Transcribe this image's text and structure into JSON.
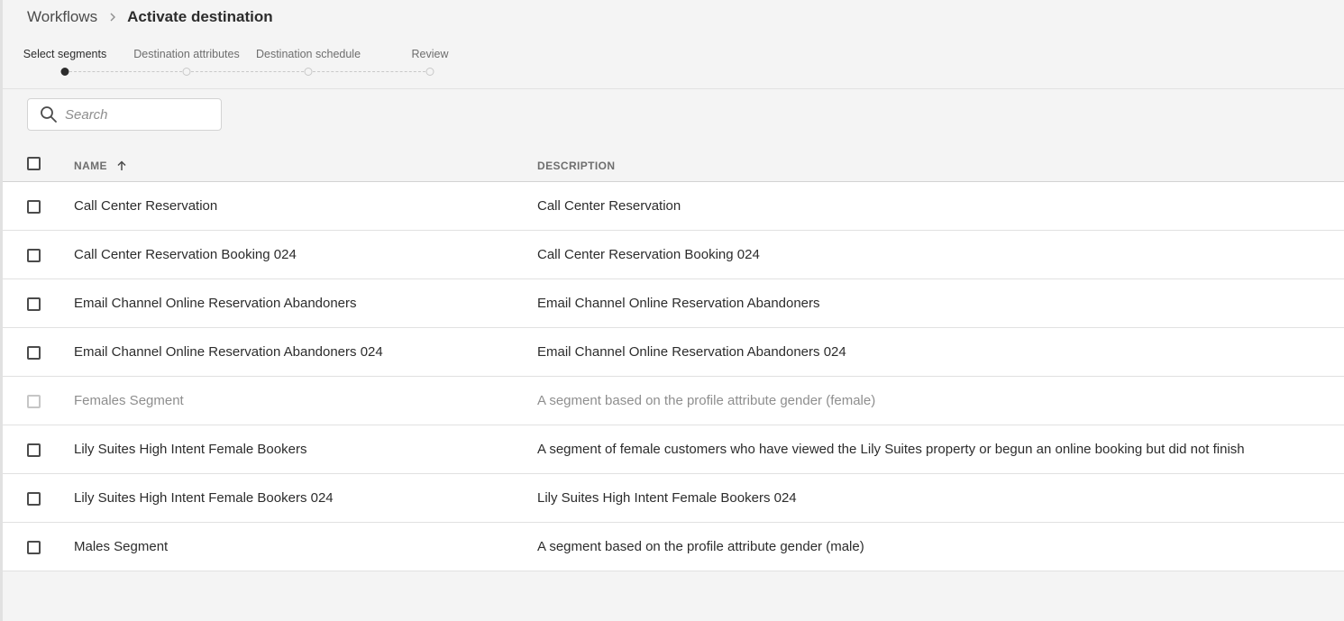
{
  "breadcrumb": {
    "parent": "Workflows",
    "current": "Activate destination"
  },
  "steps": [
    {
      "label": "Select segments",
      "active": true
    },
    {
      "label": "Destination attributes",
      "active": false
    },
    {
      "label": "Destination schedule",
      "active": false
    },
    {
      "label": "Review",
      "active": false
    }
  ],
  "search": {
    "placeholder": "Search",
    "value": ""
  },
  "table": {
    "columns": {
      "name": "NAME",
      "description": "DESCRIPTION"
    },
    "sort": {
      "column": "name",
      "direction": "ascending"
    },
    "rows": [
      {
        "name": "Call Center Reservation",
        "description": "Call Center Reservation",
        "disabled": false
      },
      {
        "name": "Call Center Reservation Booking 024",
        "description": "Call Center Reservation Booking 024",
        "disabled": false
      },
      {
        "name": "Email Channel Online Reservation Abandoners",
        "description": "Email Channel Online Reservation Abandoners",
        "disabled": false
      },
      {
        "name": "Email Channel Online Reservation Abandoners 024",
        "description": "Email Channel Online Reservation Abandoners 024",
        "disabled": false
      },
      {
        "name": "Females Segment",
        "description": "A segment based on the profile attribute gender (female)",
        "disabled": true
      },
      {
        "name": "Lily Suites High Intent Female Bookers",
        "description": "A segment of female customers who have viewed the Lily Suites property or begun an online booking but did not finish",
        "disabled": false
      },
      {
        "name": "Lily Suites High Intent Female Bookers 024",
        "description": "Lily Suites High Intent Female Bookers 024",
        "disabled": false
      },
      {
        "name": "Males Segment",
        "description": "A segment based on the profile attribute gender (male)",
        "disabled": false
      }
    ]
  },
  "colors": {
    "background": "#f4f4f4",
    "row_background": "#ffffff",
    "text": "#2c2c2c",
    "muted_text": "#6e6e6e",
    "disabled_text": "#8e8e8e",
    "active_step": "#2c2c2c"
  },
  "icons": {
    "breadcrumb_separator": "chevron-right-icon",
    "search": "search-icon",
    "sort": "arrow-up-icon"
  }
}
